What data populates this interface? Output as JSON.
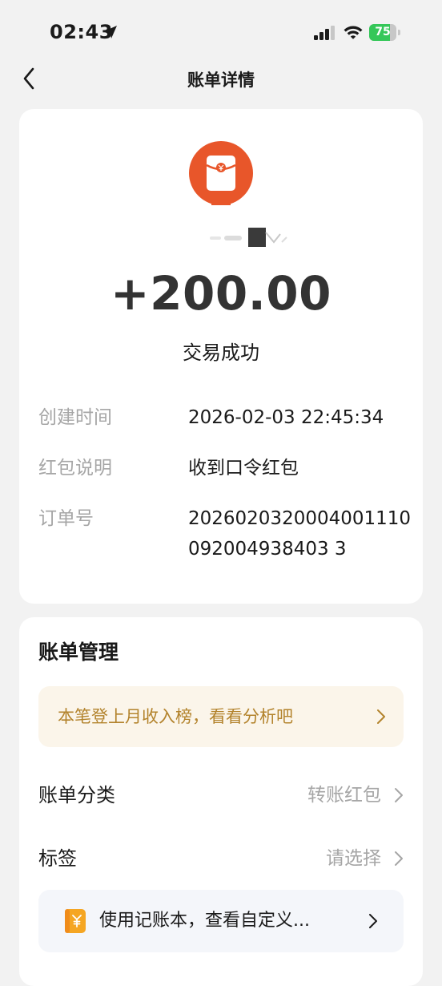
{
  "status_bar": {
    "time": "02:43",
    "battery": "75",
    "battery_level": 0.75
  },
  "nav": {
    "title": "账单详情"
  },
  "transaction": {
    "amount": "+200.00",
    "status": "交易成功",
    "details": [
      {
        "label": "创建时间",
        "value": "2026-02-03 22:45:34"
      },
      {
        "label": "红包说明",
        "value": "收到口令红包"
      },
      {
        "label": "订单号",
        "value": "2026020320004001110092004938403 3"
      }
    ]
  },
  "manage": {
    "title": "账单管理",
    "income_banner": "本笔登上月收入榜，看看分析吧",
    "category_label": "账单分类",
    "category_value": "转账红包",
    "tag_label": "标签",
    "tag_value": "请选择",
    "ledger_banner": "使用记账本，查看自定义..."
  },
  "colors": {
    "brand_orange": "#e8562a",
    "banner_text": "#b3832c",
    "banner_bg": "#fbf5ea",
    "ledger_icon": "#f5a623"
  },
  "icons": {
    "back": "chevron-left-icon",
    "location": "location-arrow-icon",
    "signal": "signal-icon",
    "wifi": "wifi-icon",
    "red_packet": "red-packet-icon",
    "ledger": "ledger-icon",
    "chevron": "chevron-right-icon"
  }
}
